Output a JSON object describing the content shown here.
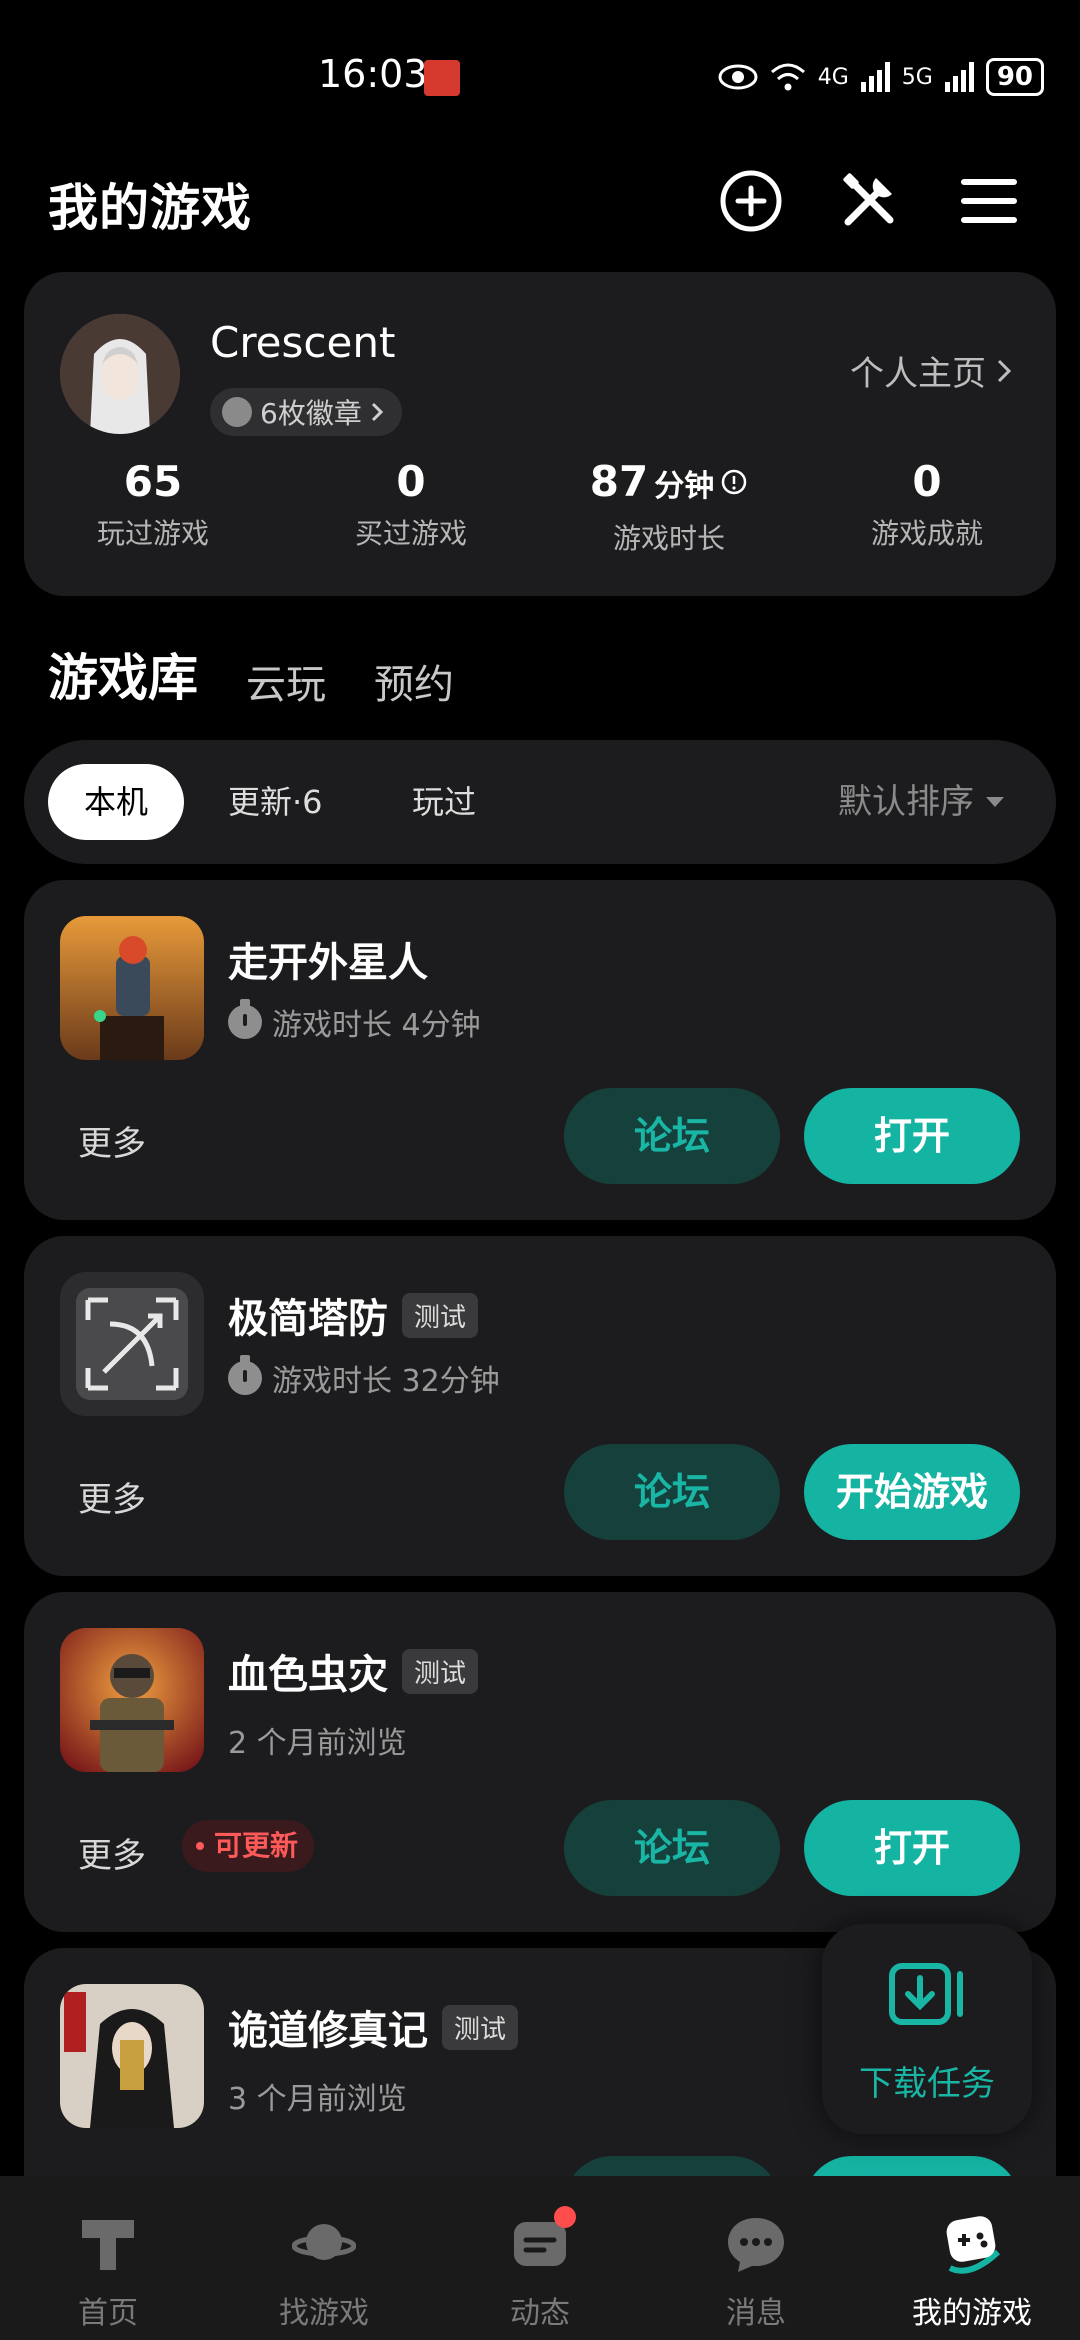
{
  "status_bar": {
    "time": "16:03",
    "battery": "90",
    "net1": "4G",
    "net2": "5G"
  },
  "header": {
    "title": "我的游戏"
  },
  "profile": {
    "username": "Crescent",
    "badges": "6枚徽章",
    "homepage_link": "个人主页",
    "stats": [
      {
        "value": "65",
        "unit": "",
        "label": "玩过游戏"
      },
      {
        "value": "0",
        "unit": "",
        "label": "买过游戏"
      },
      {
        "value": "87",
        "unit": "分钟",
        "label": "游戏时长"
      },
      {
        "value": "0",
        "unit": "",
        "label": "游戏成就"
      }
    ]
  },
  "tabs": [
    {
      "label": "游戏库"
    },
    {
      "label": "云玩"
    },
    {
      "label": "预约"
    }
  ],
  "filter": {
    "chips": [
      {
        "label": "本机"
      },
      {
        "label": "更新·6"
      },
      {
        "label": "玩过"
      }
    ],
    "sort": "默认排序"
  },
  "games": [
    {
      "name": "走开外星人",
      "tag": "",
      "meta": "游戏时长 4分钟",
      "more": "更多",
      "update": "",
      "forum": "论坛",
      "action": "打开"
    },
    {
      "name": "极简塔防",
      "tag": "测试",
      "meta": "游戏时长 32分钟",
      "more": "更多",
      "update": "",
      "forum": "论坛",
      "action": "开始游戏"
    },
    {
      "name": "血色虫灾",
      "tag": "测试",
      "meta": "2 个月前浏览",
      "more": "更多",
      "update": "可更新",
      "forum": "论坛",
      "action": "打开"
    },
    {
      "name": "诡道修真记",
      "tag": "测试",
      "meta": "3 个月前浏览",
      "more": "",
      "update": "",
      "forum": "",
      "action": ""
    }
  ],
  "download_fab": {
    "label": "下载任务"
  },
  "bottom_nav": [
    {
      "label": "首页"
    },
    {
      "label": "找游戏"
    },
    {
      "label": "动态"
    },
    {
      "label": "消息"
    },
    {
      "label": "我的游戏"
    }
  ],
  "colors": {
    "accent": "#14b3a2",
    "card": "#1c1c1e",
    "background": "#000000",
    "alert": "#ff5a5a"
  }
}
